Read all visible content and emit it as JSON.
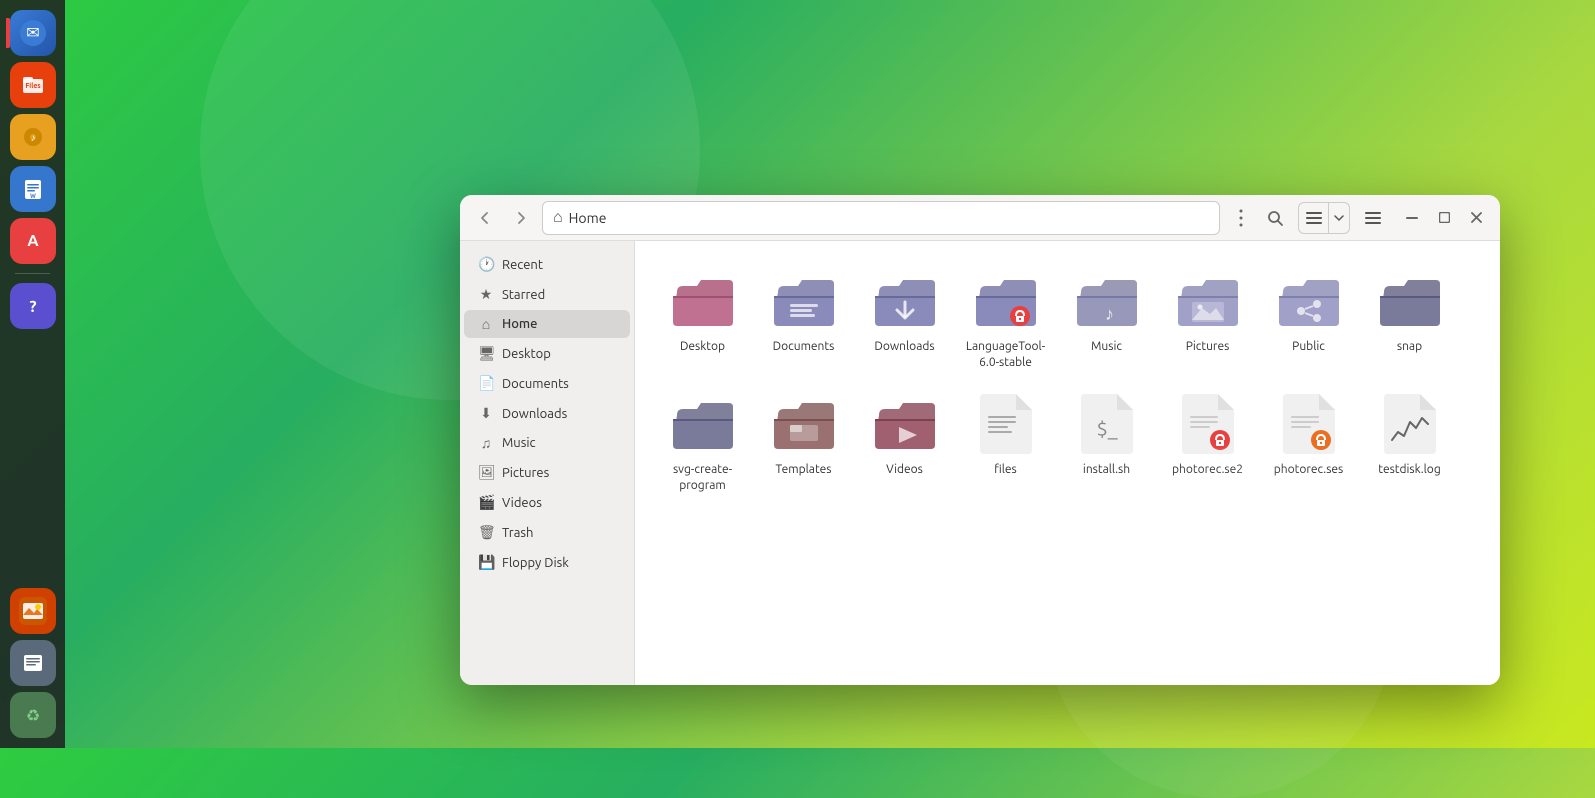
{
  "taskbar": {
    "icons": [
      {
        "name": "email",
        "label": "Email",
        "symbol": "✉",
        "bg": "#3a7bd5",
        "color": "white"
      },
      {
        "name": "files",
        "label": "Files",
        "symbol": "🗂",
        "bg": "#e8400d",
        "color": "white"
      },
      {
        "name": "audio",
        "label": "Rhythmbox",
        "symbol": "🔊",
        "bg": "#e8a020",
        "color": "white"
      },
      {
        "name": "writer",
        "label": "LibreOffice Writer",
        "symbol": "📝",
        "bg": "#3577cc",
        "color": "white"
      },
      {
        "name": "appstore",
        "label": "App Store",
        "symbol": "A",
        "bg": "#e84040",
        "color": "white"
      },
      {
        "name": "help",
        "label": "Help",
        "symbol": "?",
        "bg": "#5a4fcf",
        "color": "white"
      },
      {
        "name": "img-viewer",
        "label": "Image Viewer",
        "symbol": "🖼",
        "bg": "#e87820",
        "color": "white"
      },
      {
        "name": "text-editor",
        "label": "Text Editor",
        "symbol": "≡",
        "bg": "#5a6a7a",
        "color": "white"
      },
      {
        "name": "trash",
        "label": "Trash",
        "symbol": "♻",
        "bg": "#4a7a50",
        "color": "white"
      }
    ]
  },
  "window": {
    "title": "Home",
    "address": "Home",
    "back_btn": "‹",
    "forward_btn": "›",
    "more_btn": "⋮",
    "search_btn": "🔍",
    "view_list_btn": "≡",
    "view_grid_btn": "⊞",
    "menu_btn": "☰",
    "minimize_btn": "−",
    "maximize_btn": "□",
    "close_btn": "✕"
  },
  "sidebar": {
    "items": [
      {
        "id": "recent",
        "label": "Recent",
        "icon": "🕐",
        "active": false
      },
      {
        "id": "starred",
        "label": "Starred",
        "icon": "★",
        "active": false
      },
      {
        "id": "home",
        "label": "Home",
        "icon": "⌂",
        "active": true
      },
      {
        "id": "desktop",
        "label": "Desktop",
        "icon": "🖥",
        "active": false
      },
      {
        "id": "documents",
        "label": "Documents",
        "icon": "📄",
        "active": false
      },
      {
        "id": "downloads",
        "label": "Downloads",
        "icon": "⬇",
        "active": false
      },
      {
        "id": "music",
        "label": "Music",
        "icon": "♫",
        "active": false
      },
      {
        "id": "pictures",
        "label": "Pictures",
        "icon": "🖼",
        "active": false
      },
      {
        "id": "videos",
        "label": "Videos",
        "icon": "🎬",
        "active": false
      },
      {
        "id": "trash",
        "label": "Trash",
        "icon": "🗑",
        "active": false
      },
      {
        "id": "floppy",
        "label": "Floppy Disk",
        "icon": "💾",
        "active": false
      }
    ]
  },
  "files": {
    "items": [
      {
        "id": "desktop",
        "label": "Desktop",
        "type": "folder",
        "color": "#c05050"
      },
      {
        "id": "documents",
        "label": "Documents",
        "type": "folder",
        "color": "#7a7a9a"
      },
      {
        "id": "downloads",
        "label": "Downloads",
        "type": "folder",
        "color": "#7a7a9a",
        "badge": "download"
      },
      {
        "id": "languagetool",
        "label": "LanguageTool-6.0-stable",
        "type": "folder",
        "color": "#7a7a9a",
        "badge": "lock"
      },
      {
        "id": "music",
        "label": "Music",
        "type": "folder",
        "color": "#8a8aaa"
      },
      {
        "id": "pictures",
        "label": "Pictures",
        "type": "folder",
        "color": "#9090b0"
      },
      {
        "id": "public",
        "label": "Public",
        "type": "folder",
        "color": "#9090b0",
        "badge": "share"
      },
      {
        "id": "snap",
        "label": "snap",
        "type": "folder",
        "color": "#6a6a8a"
      },
      {
        "id": "svg-create-program",
        "label": "svg-create-program",
        "type": "folder",
        "color": "#6a6a8a"
      },
      {
        "id": "templates",
        "label": "Templates",
        "type": "folder",
        "color": "#8a6060"
      },
      {
        "id": "videos",
        "label": "Videos",
        "type": "folder",
        "color": "#905060"
      },
      {
        "id": "files",
        "label": "files",
        "type": "text-file"
      },
      {
        "id": "install-sh",
        "label": "install.sh",
        "type": "script-file"
      },
      {
        "id": "photorec-se2",
        "label": "photorec.se2",
        "type": "doc-lock-file"
      },
      {
        "id": "photorec-ses",
        "label": "photorec.ses",
        "type": "doc-lock-file"
      },
      {
        "id": "testdisk-log",
        "label": "testdisk.log",
        "type": "log-file"
      }
    ]
  }
}
